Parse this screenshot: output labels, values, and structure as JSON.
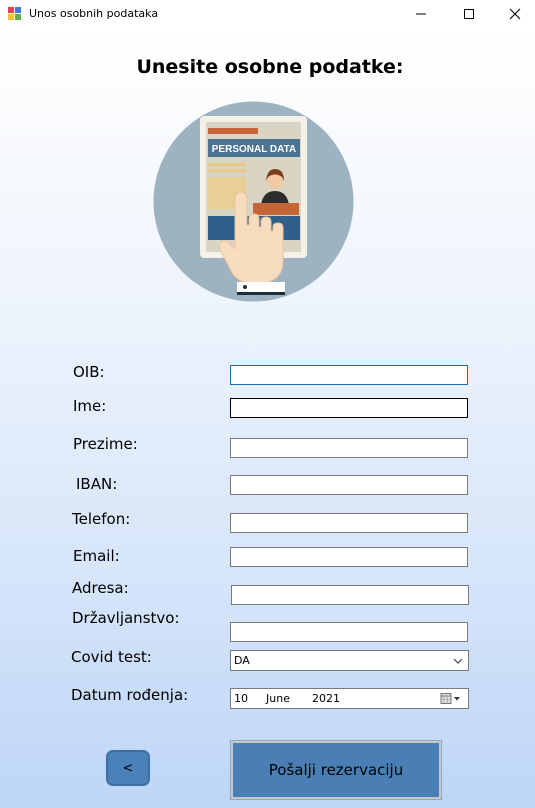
{
  "window": {
    "title": "Unos osobnih podataka",
    "minimize_glyph": "—",
    "maximize_glyph": "☐",
    "close_glyph": "✕"
  },
  "heading": "Unesite osobne podatke:",
  "illustration": {
    "banner_text": "PERSONAL DATA"
  },
  "form": {
    "oib": {
      "label": "OIB:",
      "value": ""
    },
    "ime": {
      "label": "Ime:",
      "value": ""
    },
    "prezime": {
      "label": "Prezime:",
      "value": ""
    },
    "iban": {
      "label": "IBAN:",
      "value": ""
    },
    "telefon": {
      "label": "Telefon:",
      "value": ""
    },
    "email": {
      "label": "Email:",
      "value": ""
    },
    "adresa": {
      "label": "Adresa:",
      "value": ""
    },
    "drzavljanstvo": {
      "label": "Državljanstvo:",
      "value": ""
    },
    "covid_test": {
      "label": "Covid test:",
      "value": "DA"
    },
    "datum_rodenja": {
      "label": "Datum rođenja:",
      "day": "10",
      "month": "June",
      "year": "2021"
    }
  },
  "buttons": {
    "back": "<",
    "submit": "Pošalji rezervaciju"
  },
  "colors": {
    "button_blue": "#4a7fb5",
    "illustration_circle": "#9eb3c2",
    "banner_blue": "#4b7394"
  }
}
